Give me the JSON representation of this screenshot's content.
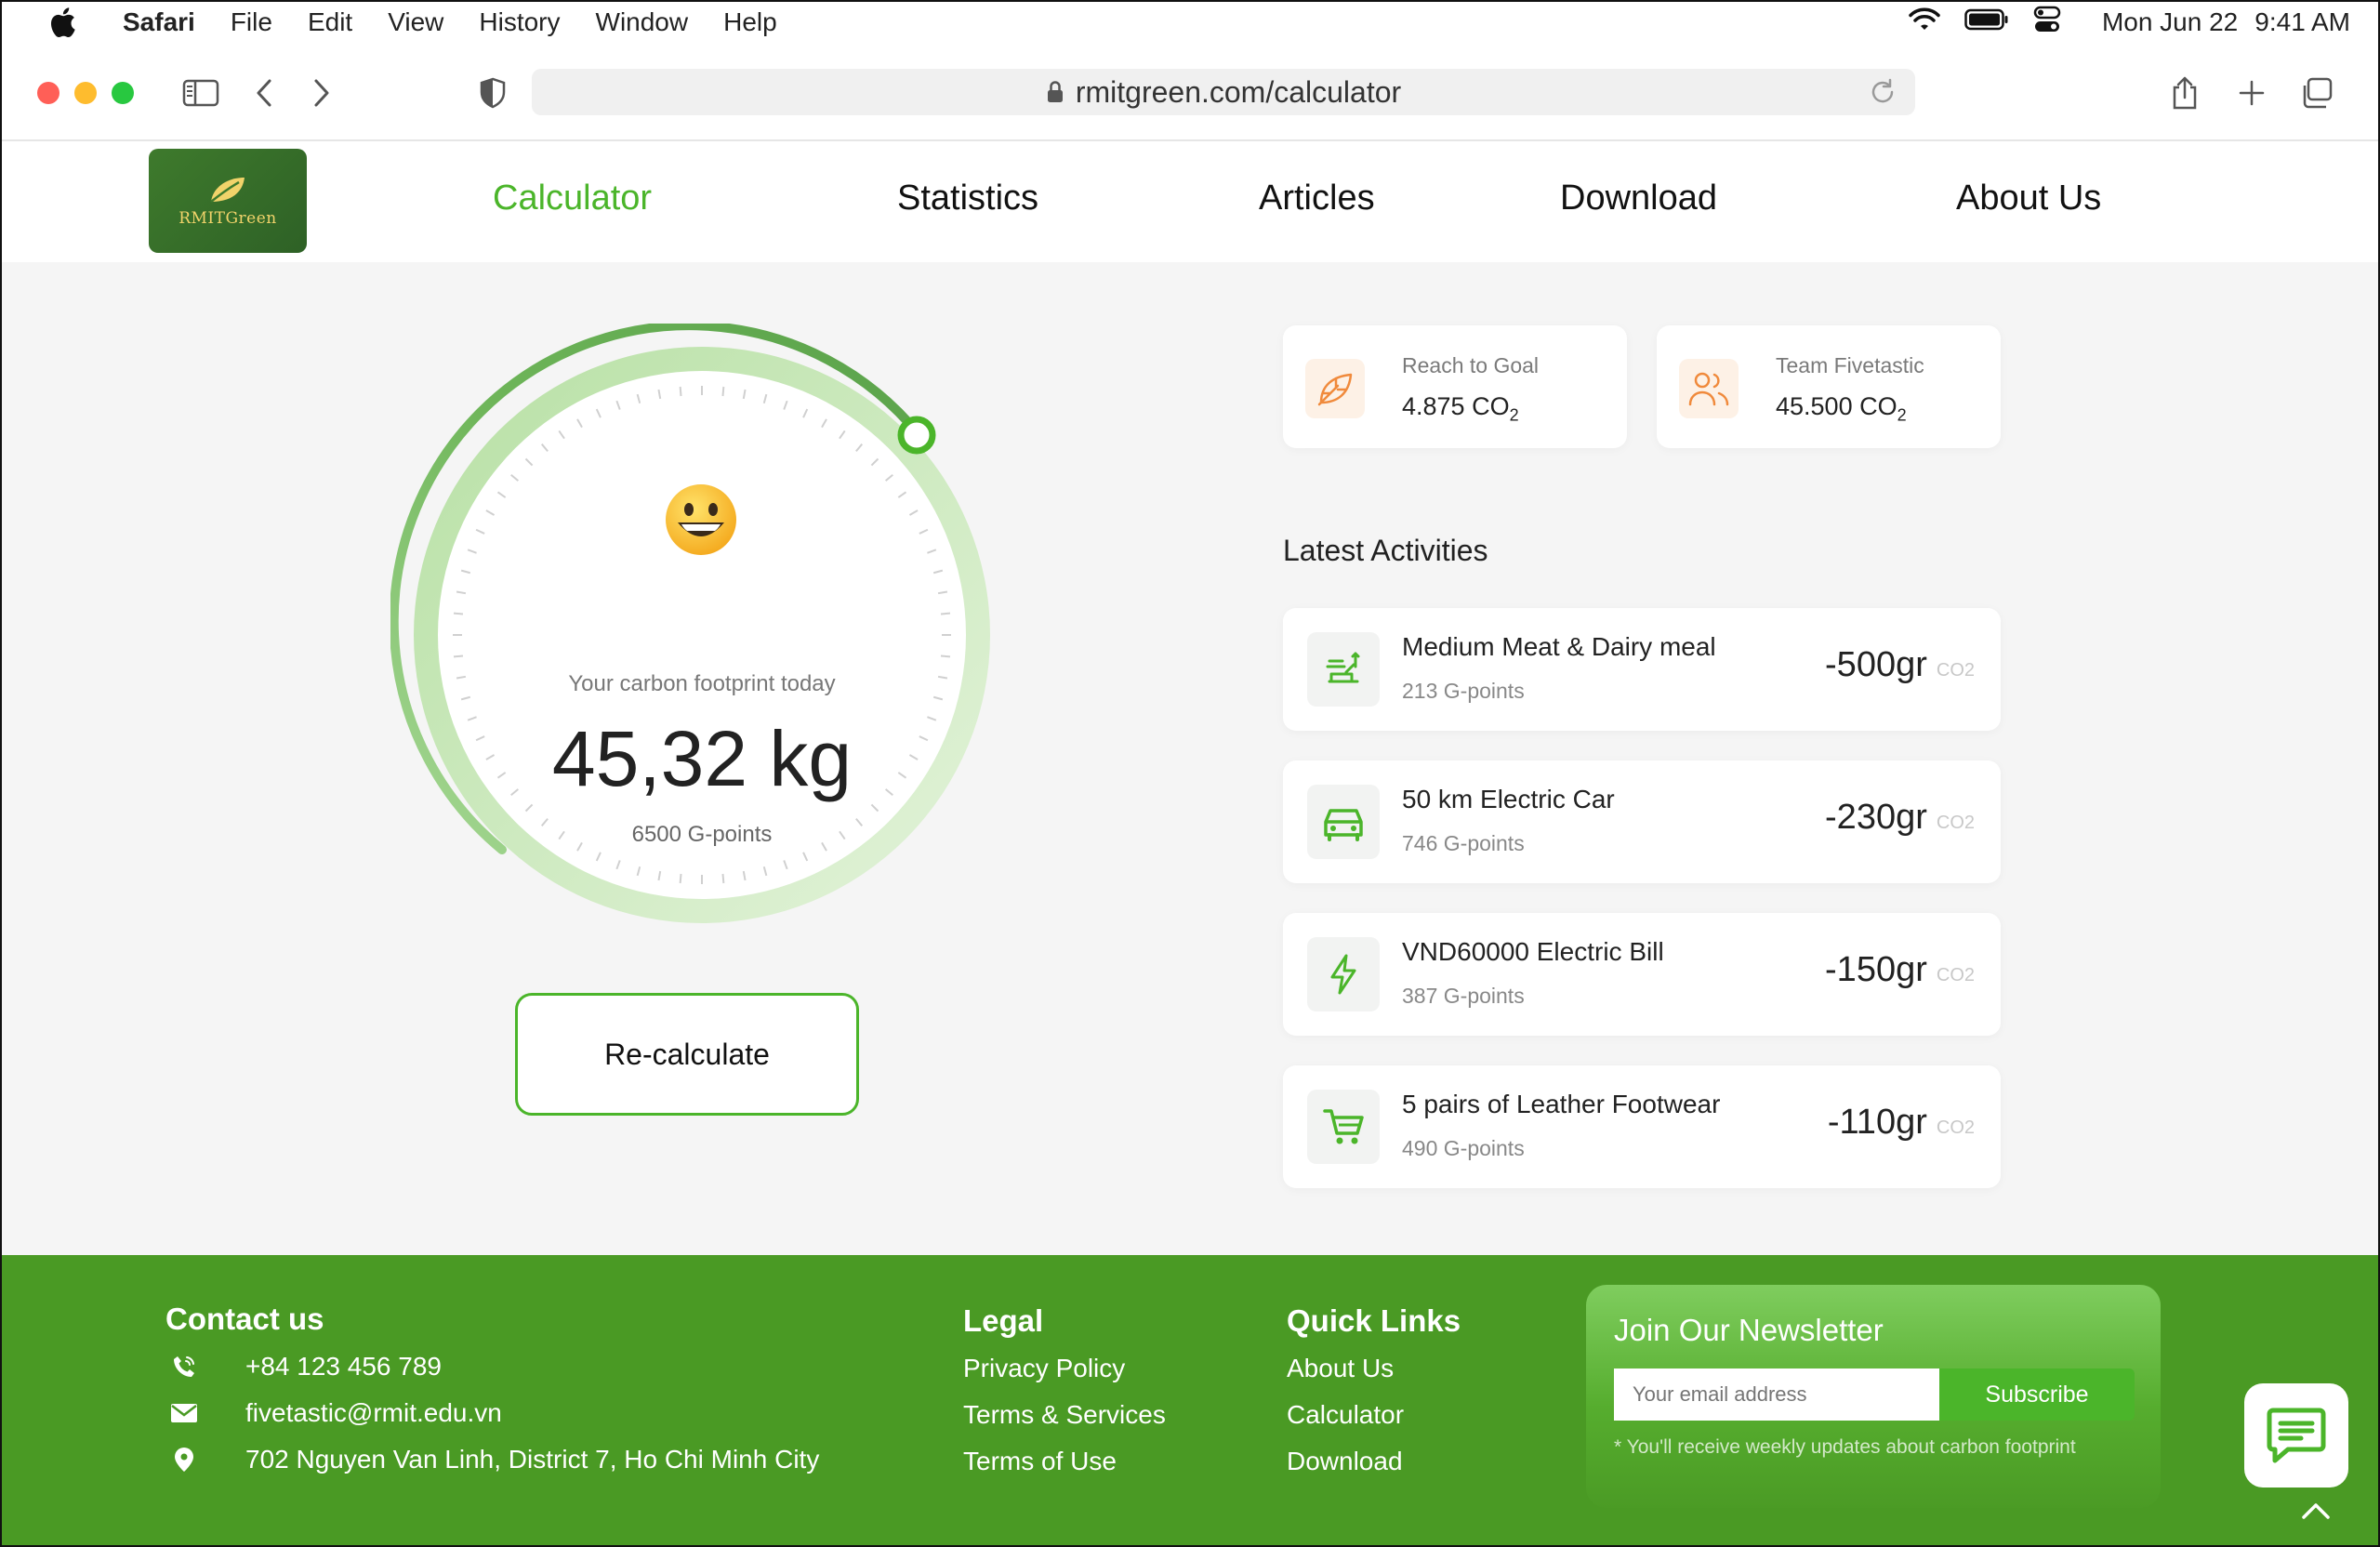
{
  "menubar": {
    "app": "Safari",
    "items": [
      "File",
      "Edit",
      "View",
      "History",
      "Window",
      "Help"
    ],
    "date": "Mon Jun 22",
    "time": "9:41 AM"
  },
  "browser": {
    "url": "rmitgreen.com/calculator"
  },
  "site": {
    "logo_text": "RMITGreen",
    "nav": [
      "Calculator",
      "Statistics",
      "Articles",
      "Download",
      "About Us"
    ],
    "active_nav": "Calculator",
    "accent_color": "#4bb52a"
  },
  "footprint": {
    "label": "Your carbon footprint today",
    "value": "45,32 kg",
    "points": "6500 G-points",
    "button": "Re-calculate"
  },
  "stats": [
    {
      "label": "Reach to Goal",
      "value": "4.875 CO",
      "sub": "2",
      "icon": "leaf-icon"
    },
    {
      "label": "Team Fivetastic",
      "value": "45.500 CO",
      "sub": "2",
      "icon": "users-icon"
    }
  ],
  "activities_title": "Latest Activities",
  "activities": [
    {
      "name": "Medium Meat & Dairy meal",
      "points": "213 G-points",
      "amount": "-500gr",
      "unit": "CO2",
      "icon": "food-icon"
    },
    {
      "name": "50 km Electric Car",
      "points": "746 G-points",
      "amount": "-230gr",
      "unit": "CO2",
      "icon": "car-icon"
    },
    {
      "name": "VND60000 Electric Bill",
      "points": "387 G-points",
      "amount": "-150gr",
      "unit": "CO2",
      "icon": "lightning-icon"
    },
    {
      "name": "5 pairs of Leather Footwear",
      "points": "490 G-points",
      "amount": "-110gr",
      "unit": "CO2",
      "icon": "cart-icon"
    }
  ],
  "footer": {
    "contact_title": "Contact us",
    "phone": "+84 123 456 789",
    "email": "fivetastic@rmit.edu.vn",
    "address": "702 Nguyen Van Linh, District 7, Ho Chi Minh City",
    "legal_title": "Legal",
    "legal": [
      "Privacy Policy",
      "Terms & Services",
      "Terms of Use"
    ],
    "quick_title": "Quick Links",
    "quick": [
      "About Us",
      "Calculator",
      "Download"
    ],
    "newsletter_title": "Join Our Newsletter",
    "newsletter_placeholder": "Your email address",
    "newsletter_button": "Subscribe",
    "newsletter_note": "* You'll receive weekly updates about carbon footprint"
  }
}
